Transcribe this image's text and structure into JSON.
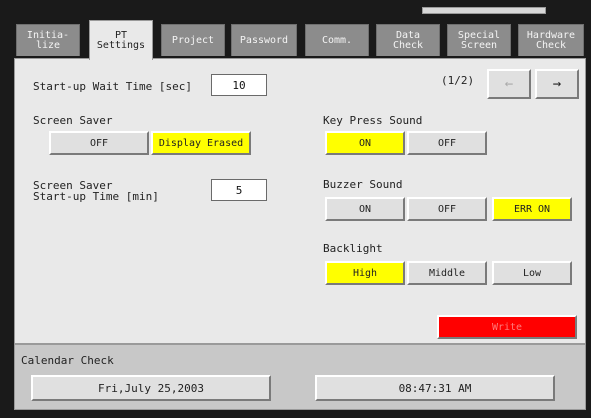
{
  "tabs": [
    {
      "label": "Initia-\nlize"
    },
    {
      "label": "PT\nSettings"
    },
    {
      "label": "Project"
    },
    {
      "label": "Password"
    },
    {
      "label": "Comm."
    },
    {
      "label": "Data\nCheck"
    },
    {
      "label": "Special\nScreen"
    },
    {
      "label": "Hardware\nCheck"
    }
  ],
  "settings": {
    "startup_wait_label": "Start-up Wait Time [sec]",
    "startup_wait_value": "10",
    "page_indicator": "(1/2)",
    "prev_icon": "←",
    "next_icon": "→",
    "screen_saver_label": "Screen Saver",
    "screen_saver_off": "OFF",
    "screen_saver_display_erased": "Display Erased",
    "ss_startup_label": "Screen Saver\nStart-up Time [min]",
    "ss_startup_value": "5",
    "key_press_label": "Key Press Sound",
    "key_press_on": "ON",
    "key_press_off": "OFF",
    "buzzer_label": "Buzzer Sound",
    "buzzer_on": "ON",
    "buzzer_off": "OFF",
    "buzzer_err_on": "ERR ON",
    "backlight_label": "Backlight",
    "backlight_high": "High",
    "backlight_middle": "Middle",
    "backlight_low": "Low",
    "write_label": "Write"
  },
  "calendar": {
    "label": "Calendar Check",
    "date": "Fri,July 25,2003",
    "time": "08:47:31 AM"
  },
  "colors": {
    "selected": "#ffff00",
    "write": "#ff0000"
  }
}
